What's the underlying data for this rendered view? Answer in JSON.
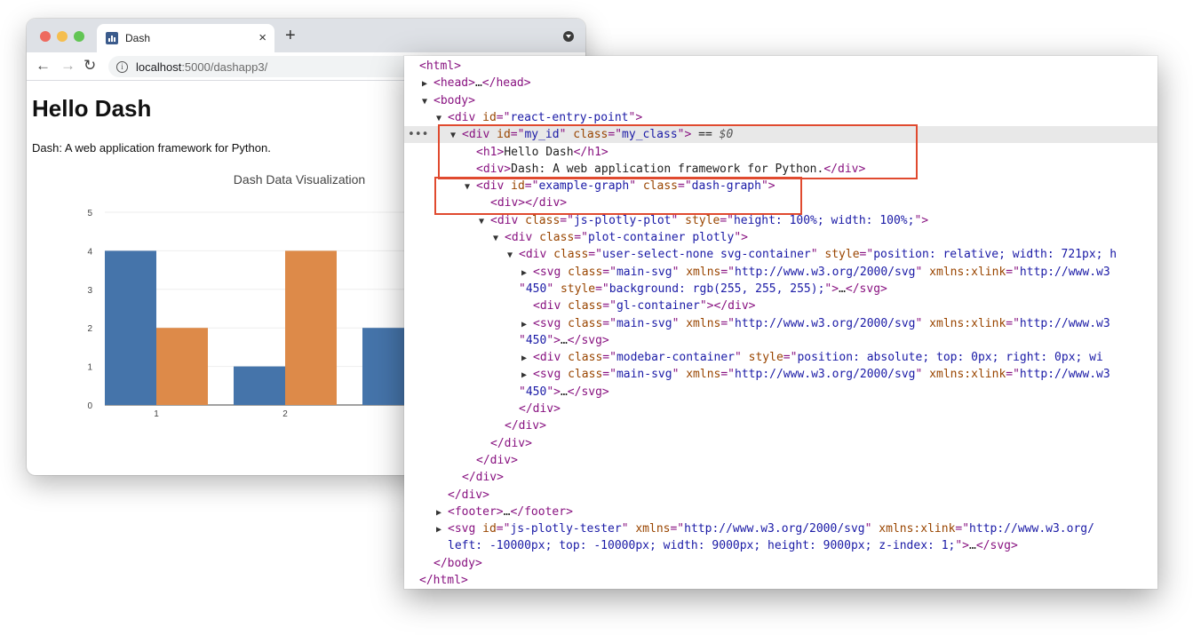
{
  "browser": {
    "tab_title": "Dash",
    "new_tab": "+",
    "close": "×",
    "url_host": "localhost",
    "url_path": ":5000/dashapp3/",
    "back": "←",
    "forward": "→",
    "reload": "↻"
  },
  "page": {
    "heading": "Hello Dash",
    "description": "Dash: A web application framework for Python."
  },
  "chart_data": {
    "type": "bar",
    "title": "Dash Data Visualization",
    "categories": [
      "1",
      "2",
      "3"
    ],
    "series": [
      {
        "values": [
          4,
          1,
          2
        ],
        "color": "#4574aa"
      },
      {
        "values": [
          2,
          4,
          null
        ],
        "color": "#dd8a49"
      }
    ],
    "ylim": [
      0,
      5
    ],
    "yticks": [
      "0",
      "1",
      "2",
      "3",
      "4",
      "5"
    ],
    "xticks_visible": [
      "1",
      "2"
    ],
    "grid": true
  },
  "devtools": {
    "lines": [
      {
        "indent": 0,
        "arrow": "",
        "html": "<span class='t'>&lt;html&gt;</span>"
      },
      {
        "indent": 1,
        "arrow": "▶",
        "html": "<span class='t'>&lt;head&gt;</span><span class='x'>…</span><span class='t'>&lt;/head&gt;</span>"
      },
      {
        "indent": 1,
        "arrow": "▼",
        "html": "<span class='t'>&lt;body&gt;</span>"
      },
      {
        "indent": 2,
        "arrow": "▼",
        "html": "<span class='t'>&lt;div </span><span class='a'>id</span><span class='t'>=\"</span><span class='v'>react-entry-point</span><span class='t'>\"&gt;</span>"
      },
      {
        "indent": 3,
        "arrow": "▼",
        "selected": true,
        "html": "<span class='t'>&lt;div </span><span class='a'>id</span><span class='t'>=\"</span><span class='v'>my_id</span><span class='t'>\" </span><span class='a'>class</span><span class='t'>=\"</span><span class='v'>my_class</span><span class='t'>\"&gt;</span><span class='x'> == </span><span class='dim'>$0</span>"
      },
      {
        "indent": 4,
        "arrow": "",
        "html": "<span class='t'>&lt;h1&gt;</span><span class='x'>Hello Dash</span><span class='t'>&lt;/h1&gt;</span>"
      },
      {
        "indent": 4,
        "arrow": "",
        "html": "<span class='t'>&lt;div&gt;</span><span class='x'>Dash: A web application framework for Python.</span><span class='t'>&lt;/div&gt;</span>"
      },
      {
        "indent": 4,
        "arrow": "▼",
        "html": "<span class='t'>&lt;div </span><span class='a'>id</span><span class='t'>=\"</span><span class='v'>example-graph</span><span class='t'>\" </span><span class='a'>class</span><span class='t'>=\"</span><span class='v'>dash-graph</span><span class='t'>\"&gt;</span>"
      },
      {
        "indent": 5,
        "arrow": "",
        "html": "<span class='t'>&lt;div&gt;&lt;/div&gt;</span>"
      },
      {
        "indent": 5,
        "arrow": "▼",
        "html": "<span class='t'>&lt;div </span><span class='a'>class</span><span class='t'>=\"</span><span class='v'>js-plotly-plot</span><span class='t'>\" </span><span class='a'>style</span><span class='t'>=\"</span><span class='v'>height: 100%; width: 100%;</span><span class='t'>\"&gt;</span>"
      },
      {
        "indent": 6,
        "arrow": "▼",
        "html": "<span class='t'>&lt;div </span><span class='a'>class</span><span class='t'>=\"</span><span class='v'>plot-container plotly</span><span class='t'>\"&gt;</span>"
      },
      {
        "indent": 7,
        "arrow": "▼",
        "html": "<span class='t'>&lt;div </span><span class='a'>class</span><span class='t'>=\"</span><span class='v'>user-select-none svg-container</span><span class='t'>\" </span><span class='a'>style</span><span class='t'>=\"</span><span class='v'>position: relative; width: 721px; h</span>"
      },
      {
        "indent": 8,
        "arrow": "▶",
        "html": "<span class='t'>&lt;svg </span><span class='a'>class</span><span class='t'>=\"</span><span class='v'>main-svg</span><span class='t'>\" </span><span class='a'>xmlns</span><span class='t'>=\"</span><span class='v'>http://www.w3.org/2000/svg</span><span class='t'>\" </span><span class='a'>xmlns:xlink</span><span class='t'>=\"</span><span class='v'>http://www.w3</span>"
      },
      {
        "indent": 7,
        "arrow": "",
        "html": "<span class='t'>\"</span><span class='v'>450</span><span class='t'>\" </span><span class='a'>style</span><span class='t'>=\"</span><span class='v'>background: rgb(255, 255, 255);</span><span class='t'>\"&gt;</span><span class='x'>…</span><span class='t'>&lt;/svg&gt;</span>"
      },
      {
        "indent": 8,
        "arrow": "",
        "html": "<span class='t'>&lt;div </span><span class='a'>class</span><span class='t'>=\"</span><span class='v'>gl-container</span><span class='t'>\"&gt;&lt;/div&gt;</span>"
      },
      {
        "indent": 8,
        "arrow": "▶",
        "html": "<span class='t'>&lt;svg </span><span class='a'>class</span><span class='t'>=\"</span><span class='v'>main-svg</span><span class='t'>\" </span><span class='a'>xmlns</span><span class='t'>=\"</span><span class='v'>http://www.w3.org/2000/svg</span><span class='t'>\" </span><span class='a'>xmlns:xlink</span><span class='t'>=\"</span><span class='v'>http://www.w3</span>"
      },
      {
        "indent": 7,
        "arrow": "",
        "html": "<span class='t'>\"</span><span class='v'>450</span><span class='t'>\"&gt;</span><span class='x'>…</span><span class='t'>&lt;/svg&gt;</span>"
      },
      {
        "indent": 8,
        "arrow": "▶",
        "html": "<span class='t'>&lt;div </span><span class='a'>class</span><span class='t'>=\"</span><span class='v'>modebar-container</span><span class='t'>\" </span><span class='a'>style</span><span class='t'>=\"</span><span class='v'>position: absolute; top: 0px; right: 0px; wi</span>"
      },
      {
        "indent": 8,
        "arrow": "▶",
        "html": "<span class='t'>&lt;svg </span><span class='a'>class</span><span class='t'>=\"</span><span class='v'>main-svg</span><span class='t'>\" </span><span class='a'>xmlns</span><span class='t'>=\"</span><span class='v'>http://www.w3.org/2000/svg</span><span class='t'>\" </span><span class='a'>xmlns:xlink</span><span class='t'>=\"</span><span class='v'>http://www.w3</span>"
      },
      {
        "indent": 7,
        "arrow": "",
        "html": "<span class='t'>\"</span><span class='v'>450</span><span class='t'>\"&gt;</span><span class='x'>…</span><span class='t'>&lt;/svg&gt;</span>"
      },
      {
        "indent": 7,
        "arrow": "",
        "html": "<span class='t'>&lt;/div&gt;</span>"
      },
      {
        "indent": 6,
        "arrow": "",
        "html": "<span class='t'>&lt;/div&gt;</span>"
      },
      {
        "indent": 5,
        "arrow": "",
        "html": "<span class='t'>&lt;/div&gt;</span>"
      },
      {
        "indent": 4,
        "arrow": "",
        "html": "<span class='t'>&lt;/div&gt;</span>"
      },
      {
        "indent": 3,
        "arrow": "",
        "html": "<span class='t'>&lt;/div&gt;</span>"
      },
      {
        "indent": 2,
        "arrow": "",
        "html": "<span class='t'>&lt;/div&gt;</span>"
      },
      {
        "indent": 2,
        "arrow": "▶",
        "html": "<span class='t'>&lt;footer&gt;</span><span class='x'>…</span><span class='t'>&lt;/footer&gt;</span>"
      },
      {
        "indent": 2,
        "arrow": "▶",
        "html": "<span class='t'>&lt;svg </span><span class='a'>id</span><span class='t'>=\"</span><span class='v'>js-plotly-tester</span><span class='t'>\" </span><span class='a'>xmlns</span><span class='t'>=\"</span><span class='v'>http://www.w3.org/2000/svg</span><span class='t'>\" </span><span class='a'>xmlns:xlink</span><span class='t'>=\"</span><span class='v'>http://www.w3.org/</span>"
      },
      {
        "indent": 2,
        "arrow": "",
        "html": "<span class='v'>left: -10000px; top: -10000px; width: 9000px; height: 9000px; z-index: 1;</span><span class='t'>\"&gt;</span><span class='x'>…</span><span class='t'>&lt;/svg&gt;</span>"
      },
      {
        "indent": 1,
        "arrow": "",
        "html": "<span class='t'>&lt;/body&gt;</span>"
      },
      {
        "indent": 0,
        "arrow": "",
        "html": "<span class='t'>&lt;/html&gt;</span>"
      }
    ],
    "selected_ellipsis": "•••"
  }
}
